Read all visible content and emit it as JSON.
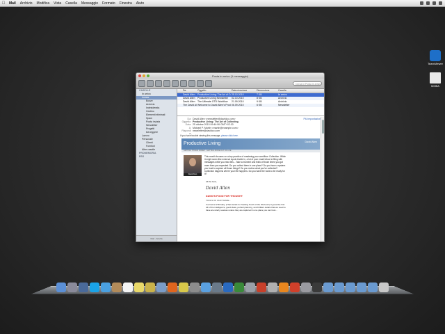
{
  "menubar": {
    "apple": "",
    "items": [
      "Mail",
      "Archivio",
      "Modifica",
      "Vista",
      "Casella",
      "Messaggio",
      "Formato",
      "Finestra",
      "Aiuto"
    ]
  },
  "desktop_icons": [
    {
      "label": "TeamViewer",
      "color": "#1e6fc8"
    },
    {
      "label": "MOBA",
      "color": "#e8e8e8"
    }
  ],
  "window": {
    "title": "Posta in arrivo (1 messaggio)",
    "search_placeholder": "Cerca in Posta in arrivo",
    "sidebar": [
      {
        "text": "CASELLE",
        "kind": "head"
      },
      {
        "text": "In arrivo",
        "kind": "i1"
      },
      {
        "text": "Inviata",
        "kind": "i1",
        "selected": true
      },
      {
        "text": "Bozze",
        "kind": "i2"
      },
      {
        "text": "Archivio",
        "kind": "i2"
      },
      {
        "text": "Indesiderata",
        "kind": "i2"
      },
      {
        "text": "Cestino",
        "kind": "i2"
      },
      {
        "text": "Elementi eliminati",
        "kind": "i2"
      },
      {
        "text": "Spam",
        "kind": "i2"
      },
      {
        "text": "Posta inviata",
        "kind": "i2"
      },
      {
        "text": "Newsletter",
        "kind": "i2"
      },
      {
        "text": "Progetti",
        "kind": "i2"
      },
      {
        "text": "Da leggere",
        "kind": "i2"
      },
      {
        "text": "Lavoro",
        "kind": "i1"
      },
      {
        "text": "Personale",
        "kind": "i1"
      },
      {
        "text": "Clienti",
        "kind": "i2"
      },
      {
        "text": "Fornitori",
        "kind": "i2"
      },
      {
        "text": "Altre caselle",
        "kind": "i1"
      },
      {
        "text": "PROMEMORIA",
        "kind": "head"
      },
      {
        "text": "RSS",
        "kind": "head"
      }
    ],
    "sidebar_footer": "Mail - Attività",
    "list_header": [
      "",
      "Da",
      "Oggetto",
      "Data ricezione",
      "",
      "Dimensione",
      "Casella",
      ""
    ],
    "messages": [
      {
        "from": "David Allen",
        "subject": "Productive Living: The Art of Collecting",
        "date": "25.10.2010",
        "cat": "",
        "size": "7 KB",
        "box": "In arrivo",
        "selected": true
      },
      {
        "from": "David Allen",
        "subject": "Productive Living Newsletter",
        "date": "02.10.2010",
        "cat": "",
        "size": "8 KB",
        "box": "Archivio"
      },
      {
        "from": "David Allen",
        "subject": "The Ultimate GTD Workflow",
        "date": "21.09.2010",
        "cat": "",
        "size": "9 KB",
        "box": "Archivio"
      },
      {
        "from": "The David Allen Co.",
        "subject": "Welcome to David Allen's Prod...",
        "date": "06.09.2010",
        "cat": "",
        "size": "6 KB",
        "box": "Newsletter"
      }
    ],
    "header": {
      "from_label": "Da:",
      "from": "David Allen <newsletter@davidco.com>",
      "subject_label": "Oggetto:",
      "subject": "Productive Living: The Art of Collecting",
      "date_label": "Data:",
      "date": "25 ottobre 2010 09:44:06 GMT+02.00",
      "to_label": "A:",
      "to": "Michael P. Martin <martin@example.com>",
      "reply_label": "Rispondi a:",
      "reply": "newsletter@davidco.com",
      "link": "Più impostazioni"
    },
    "notice": "If you have trouble viewing this message,",
    "notice_link": "please click here.",
    "newsletter": {
      "title": "Productive Living",
      "logo": "David Allen",
      "bar": "GETTING THINGS DONE® · GETTING MORE OUT OF LIFE",
      "photo_caption": "David Allen",
      "intro": "This month focuses on a key practice of mastering your workflow: Collection. While it might seem like external inputs trickle in, a lot of your email inbox is filling with messages while you read this... Take a moment and think of those times you got more than you expected. Do you collect them in one place? Do you have a system you trust to capture all those things? Do you review what you've collected? Collection happens where your life happens. Do you have the tools to be ready for it?",
      "sign_off": "All the best,",
      "signature": "David Allen",
      "section": "DAVID'S FOOD FOR THOUGHT",
      "section_sub": "TOOLS OF OUR TRADE...",
      "section_text": "I've had a GTD baby. (That stands for 'Getting Touch of the Obvious!') It goes like this: All of the intelligence, good ideas, perfect planning, and brilliant details that we need to have are utterly useless unless they are captured in one place you can trust..."
    }
  },
  "dock": [
    {
      "name": "finder",
      "color": "#5b8fd6"
    },
    {
      "name": "launchpad",
      "color": "#8a8a9a"
    },
    {
      "name": "mission-control",
      "color": "#4a6a9a"
    },
    {
      "name": "skype",
      "color": "#1aa3e8"
    },
    {
      "name": "safari",
      "color": "#4aa0e0"
    },
    {
      "name": "address-book",
      "color": "#b28b5a"
    },
    {
      "name": "calendar",
      "color": "#f4f4f4"
    },
    {
      "name": "notes",
      "color": "#e8d86a"
    },
    {
      "name": "stickies",
      "color": "#c9b24a"
    },
    {
      "name": "mail",
      "color": "#7a9cc8"
    },
    {
      "name": "firefox",
      "color": "#e0651e"
    },
    {
      "name": "chrome",
      "color": "#d8c84a"
    },
    {
      "name": "system-preferences",
      "color": "#8c8c8c"
    },
    {
      "name": "itunes",
      "color": "#5aa0e0"
    },
    {
      "name": "iphoto",
      "color": "#6a7a8a"
    },
    {
      "name": "photoshop",
      "color": "#2a6ac0"
    },
    {
      "name": "dreamweaver",
      "color": "#3a8a3a"
    },
    {
      "name": "preview",
      "color": "#9aa0a8"
    },
    {
      "name": "flash",
      "color": "#c8402a"
    },
    {
      "name": "automator",
      "color": "#b0b0b0"
    },
    {
      "name": "vlc",
      "color": "#e8861e"
    },
    {
      "name": "filezilla",
      "color": "#d0402a"
    },
    {
      "name": "grab",
      "color": "#9a9aa0"
    },
    {
      "name": "terminal",
      "color": "#3a3a3a"
    },
    {
      "name": "applications-folder",
      "color": "#6a9ad0"
    },
    {
      "name": "documents-folder",
      "color": "#6a9ad0"
    },
    {
      "name": "downloads-folder",
      "color": "#6a9ad0"
    },
    {
      "name": "desktop-folder",
      "color": "#6a9ad0"
    },
    {
      "name": "stack-folder",
      "color": "#6a9ad0"
    },
    {
      "name": "trash",
      "color": "#c8c8c8"
    }
  ]
}
